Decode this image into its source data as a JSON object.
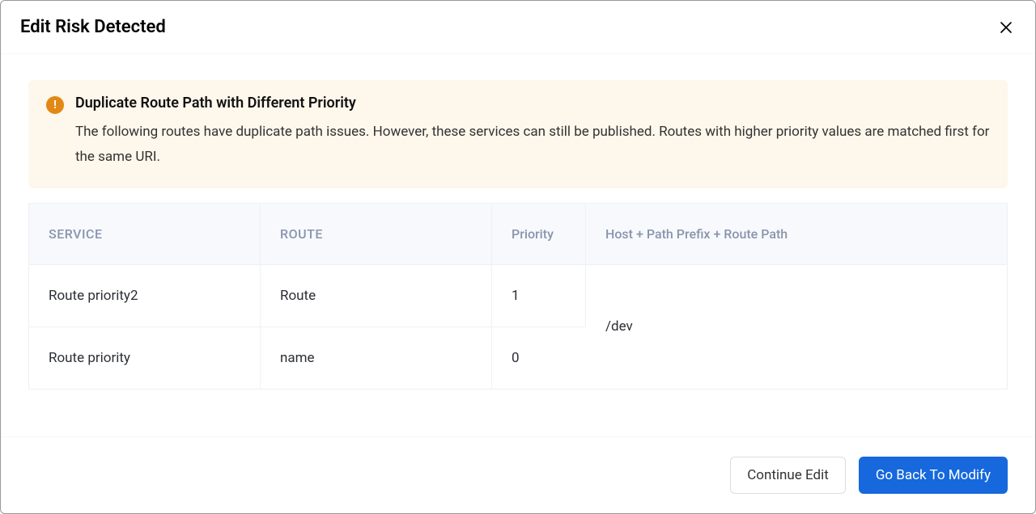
{
  "modal": {
    "title": "Edit Risk Detected"
  },
  "alert": {
    "title": "Duplicate Route Path with Different Priority",
    "description": "The following routes have duplicate path issues. However, these services can still be published. Routes with higher priority values are matched first for the same URI."
  },
  "table": {
    "headers": {
      "service": "SERVICE",
      "route": "ROUTE",
      "priority": "Priority",
      "hostpath": "Host + Path Prefix + Route Path"
    },
    "rows": [
      {
        "service": "Route priority2",
        "route": "Route",
        "priority": "1"
      },
      {
        "service": "Route priority",
        "route": "name",
        "priority": "0"
      }
    ],
    "merged_hostpath": "/dev"
  },
  "footer": {
    "continue": "Continue Edit",
    "goback": "Go Back To Modify"
  }
}
